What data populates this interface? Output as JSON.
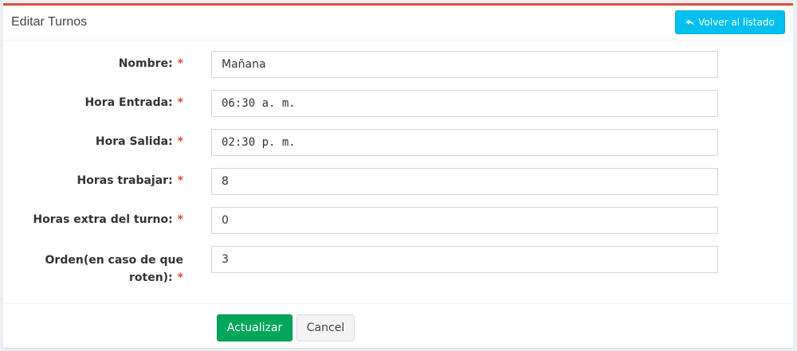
{
  "header": {
    "title": "Editar Turnos",
    "back_button_label": "Volver al listado",
    "back_button_icon": "reply-icon"
  },
  "form": {
    "required_mark": "*",
    "fields": [
      {
        "label": "Nombre:",
        "value": "Mañana"
      },
      {
        "label": "Hora Entrada:",
        "value": "06:30 a. m."
      },
      {
        "label": "Hora Salida:",
        "value": "02:30 p. m."
      },
      {
        "label": "Horas trabajar:",
        "value": "8"
      },
      {
        "label": "Horas extra del turno:",
        "value": "0"
      },
      {
        "label_line1": "Orden(en caso de que",
        "label_line2": "roten):",
        "value": "3"
      }
    ]
  },
  "footer": {
    "update_label": "Actualizar",
    "cancel_label": "Cancel"
  },
  "colors": {
    "top_border": "#dd4b39",
    "info_button": "#00c0ef",
    "success_button": "#00a65a",
    "required_mark": "#dd4b39"
  }
}
